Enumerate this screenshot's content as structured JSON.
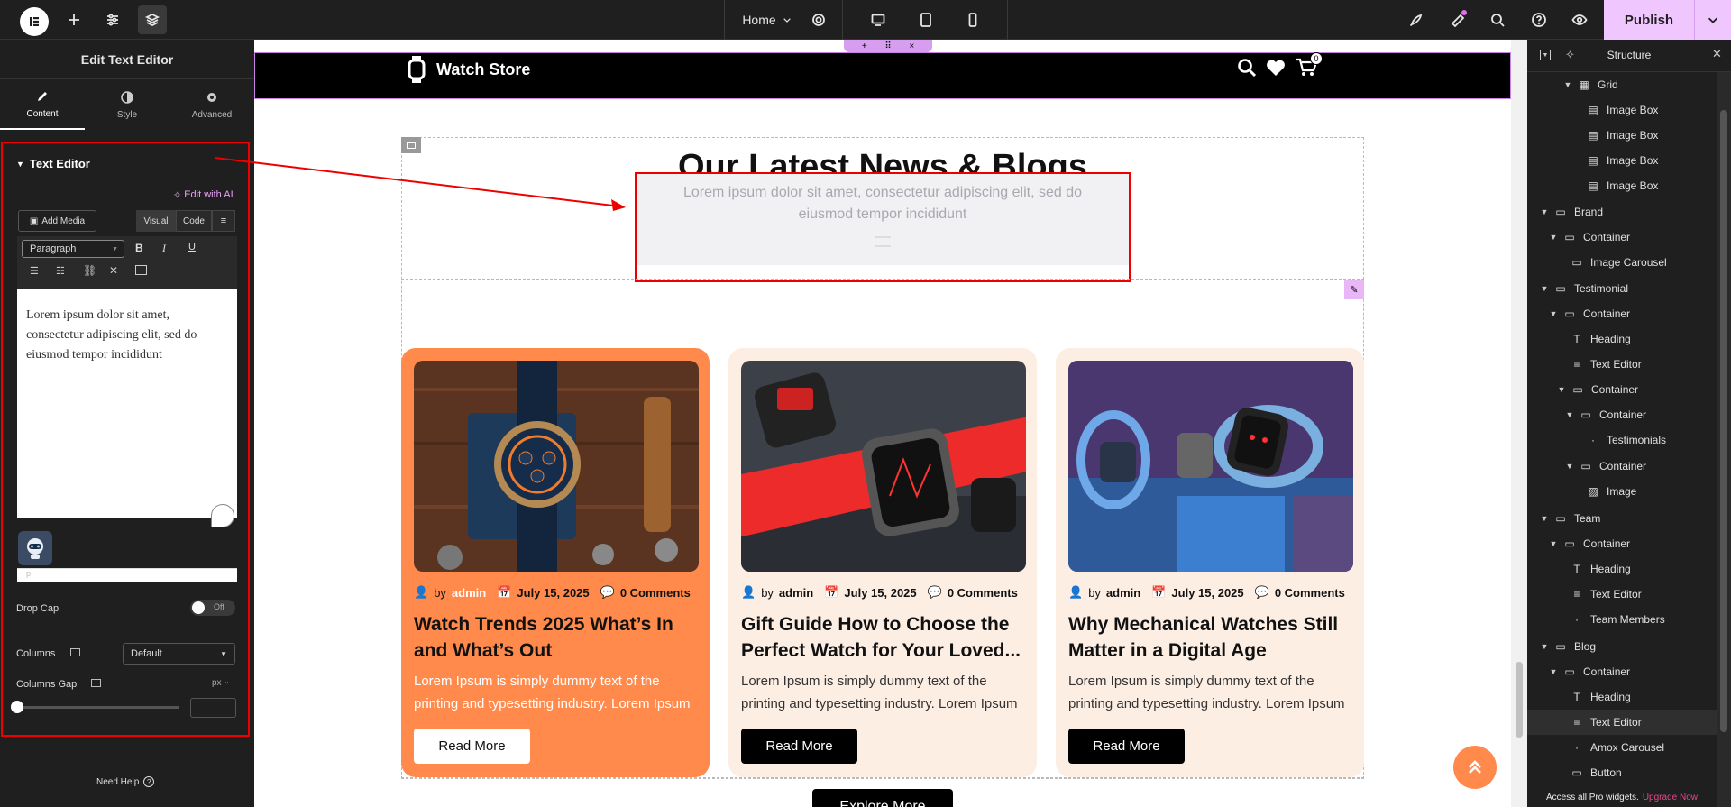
{
  "topbar": {
    "page_select": "Home",
    "publish_label": "Publish"
  },
  "left_panel": {
    "title": "Edit Text Editor",
    "tabs": [
      {
        "label": "Content"
      },
      {
        "label": "Style"
      },
      {
        "label": "Advanced"
      }
    ],
    "section_title": "Text Editor",
    "edit_with_ai": "Edit with AI",
    "add_media": "Add Media",
    "visual_tab": "Visual",
    "code_tab": "Code",
    "format_select": "Paragraph",
    "editor_content": "Lorem ipsum dolor sit amet, consectetur adipiscing elit, sed do eiusmod tempor incididunt",
    "editor_status": "p",
    "drop_cap_label": "Drop Cap",
    "drop_cap_value": "Off",
    "columns_label": "Columns",
    "columns_value": "Default",
    "columns_gap_label": "Columns Gap",
    "columns_gap_unit": "px",
    "need_help": "Need Help"
  },
  "site": {
    "brand": "Watch Store",
    "cart_count": "0",
    "section_heading": "Our Latest News & Blogs",
    "section_text": "Lorem ipsum dolor sit amet, consectetur adipiscing elit, sed do eiusmod tempor incididunt",
    "explore_button": "Explore More",
    "cards": [
      {
        "by": "by",
        "author": "admin",
        "date": "July 15, 2025",
        "comments": "0 Comments",
        "title": "Watch Trends 2025 What’s In and What’s Out",
        "desc": "Lorem Ipsum is simply dummy text of the printing and typesetting industry. Lorem Ipsum",
        "button": "Read More"
      },
      {
        "by": "by",
        "author": "admin",
        "date": "July 15, 2025",
        "comments": "0 Comments",
        "title": "Gift Guide How to Choose the Perfect Watch for Your Loved...",
        "desc": "Lorem Ipsum is simply dummy text of the printing and typesetting industry. Lorem Ipsum",
        "button": "Read More"
      },
      {
        "by": "by",
        "author": "admin",
        "date": "July 15, 2025",
        "comments": "0 Comments",
        "title": "Why Mechanical Watches Still Matter in a Digital Age",
        "desc": "Lorem Ipsum is simply dummy text of the printing and typesetting industry. Lorem Ipsum",
        "button": "Read More"
      }
    ]
  },
  "structure": {
    "title": "Structure",
    "items": [
      {
        "label": "Grid"
      },
      {
        "label": "Image Box"
      },
      {
        "label": "Image Box"
      },
      {
        "label": "Image Box"
      },
      {
        "label": "Image Box"
      },
      {
        "label": "Brand"
      },
      {
        "label": "Container"
      },
      {
        "label": "Image Carousel"
      },
      {
        "label": "Testimonial"
      },
      {
        "label": "Container"
      },
      {
        "label": "Heading"
      },
      {
        "label": "Text Editor"
      },
      {
        "label": "Container"
      },
      {
        "label": "Container"
      },
      {
        "label": "Testimonials"
      },
      {
        "label": "Container"
      },
      {
        "label": "Image"
      },
      {
        "label": "Team"
      },
      {
        "label": "Container"
      },
      {
        "label": "Heading"
      },
      {
        "label": "Text Editor"
      },
      {
        "label": "Team Members"
      },
      {
        "label": "Blog"
      },
      {
        "label": "Container"
      },
      {
        "label": "Heading"
      },
      {
        "label": "Text Editor"
      },
      {
        "label": "Amox Carousel"
      },
      {
        "label": "Button"
      }
    ],
    "footer_text": "Access all Pro widgets.",
    "footer_link": "Upgrade Now"
  },
  "colors": {
    "accent_orange": "#ff8a4c",
    "card_bg_light": "#fdeee4",
    "publish_bg": "#f0c6ff",
    "panel_bg": "#1f1f1f",
    "highlight_red": "#e00000"
  }
}
